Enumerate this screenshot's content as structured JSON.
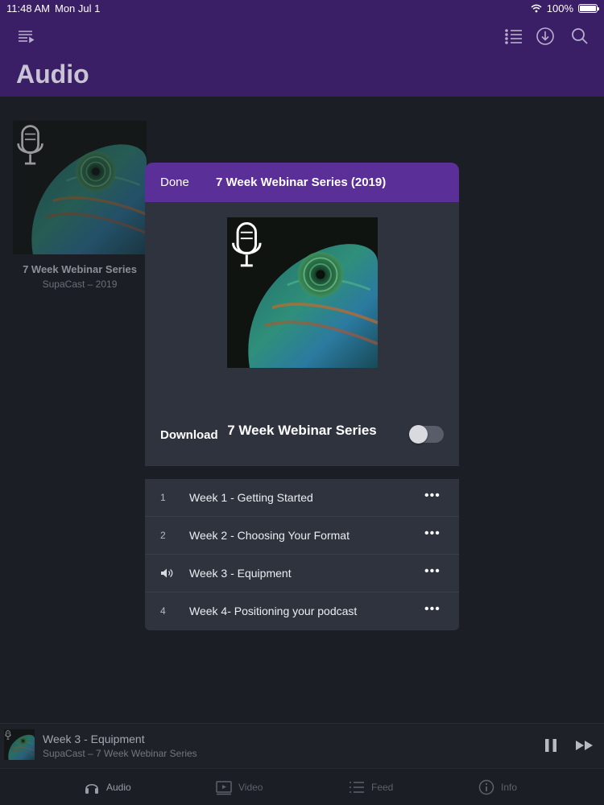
{
  "status_bar": {
    "time": "11:48 AM",
    "date": "Mon Jul 1",
    "battery": "100%"
  },
  "header": {
    "title": "Audio",
    "icons": [
      "menu-list-icon",
      "queue-list-icon",
      "download-icon",
      "search-icon"
    ]
  },
  "library": {
    "items": [
      {
        "title": "7 Week Webinar Series",
        "subtitle": "SupaCast – 2019"
      }
    ]
  },
  "modal": {
    "done_label": "Done",
    "title": "7 Week Webinar Series (2019)",
    "series_name": "7 Week Webinar Series",
    "download_label": "Download",
    "download_enabled": false,
    "tracks": [
      {
        "number": "1",
        "title": "Week 1 - Getting Started",
        "playing": false
      },
      {
        "number": "2",
        "title": "Week 2 - Choosing Your Format",
        "playing": false
      },
      {
        "number": "3",
        "title": "Week 3 - Equipment",
        "playing": true
      },
      {
        "number": "4",
        "title": "Week 4- Positioning your podcast",
        "playing": false
      }
    ],
    "more_label": "•••"
  },
  "mini_player": {
    "title": "Week 3 - Equipment",
    "subtitle": "SupaCast – 7 Week Webinar Series"
  },
  "tabs": [
    {
      "label": "Audio",
      "icon": "headphones-icon",
      "active": true
    },
    {
      "label": "Video",
      "icon": "video-icon",
      "active": false
    },
    {
      "label": "Feed",
      "icon": "feed-list-icon",
      "active": false
    },
    {
      "label": "Info",
      "icon": "info-icon",
      "active": false
    }
  ],
  "colors": {
    "header_bg": "#3b1f66",
    "modal_header_bg": "#5a2f97",
    "panel_bg": "#2e333e",
    "page_bg": "#1c1e25"
  }
}
